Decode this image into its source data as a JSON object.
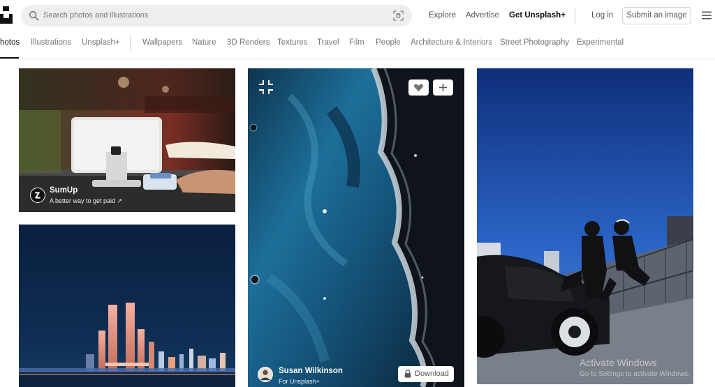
{
  "header": {
    "search_placeholder": "Search photos and illustrations",
    "explore": "Explore",
    "advertise": "Advertise",
    "get_unsplash_plus": "Get Unsplash+",
    "login": "Log in",
    "submit": "Submit an image"
  },
  "tabs": [
    "Photos",
    "Illustrations",
    "Unsplash+",
    "Wallpapers",
    "Nature",
    "3D Renders",
    "Textures",
    "Travel",
    "Film",
    "People",
    "Architecture & Interiors",
    "Street Photography",
    "Experimental"
  ],
  "tab_first_visible": "hotos",
  "photos": {
    "sumup": {
      "name": "SumUp",
      "tagline": "A better way to get paid ↗"
    },
    "abstract": {
      "author": "Susan Wilkinson",
      "sub": "For Unsplash+",
      "download": "Download"
    }
  },
  "watermark": {
    "title": "Activate Windows",
    "sub": "Go to Settings to activate Windows."
  },
  "colors": {
    "search_bg": "#eeeeee",
    "text_muted": "#767676",
    "sky_blue": "#1e4aa0",
    "night_sky": "#0a1f3e",
    "fluid_blue": "#1d6f99"
  }
}
